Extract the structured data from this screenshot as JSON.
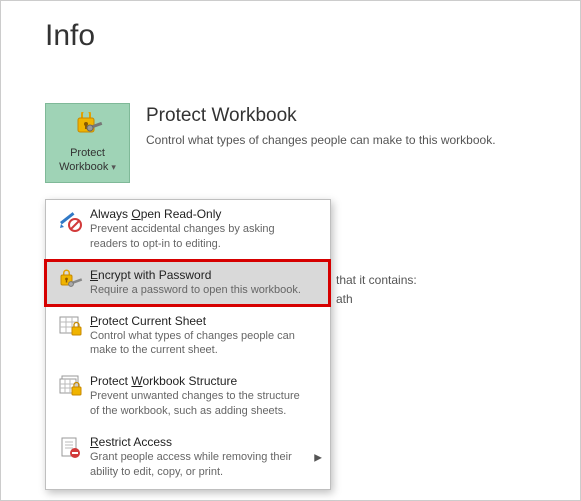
{
  "page": {
    "title": "Info"
  },
  "protectButton": {
    "line1": "Protect",
    "line2": "Workbook"
  },
  "section": {
    "heading": "Protect Workbook",
    "description": "Control what types of changes people can make to this workbook."
  },
  "behind": {
    "line1": "that it contains:",
    "line2": "ath"
  },
  "menu": {
    "items": [
      {
        "titlePre": "Always ",
        "titleUl": "O",
        "titlePost": "pen Read-Only",
        "desc": "Prevent accidental changes by asking readers to opt-in to editing."
      },
      {
        "titlePre": "",
        "titleUl": "E",
        "titlePost": "ncrypt with Password",
        "desc": "Require a password to open this workbook."
      },
      {
        "titlePre": "",
        "titleUl": "P",
        "titlePost": "rotect Current Sheet",
        "desc": "Control what types of changes people can make to the current sheet."
      },
      {
        "titlePre": "Protect ",
        "titleUl": "W",
        "titlePost": "orkbook Structure",
        "desc": "Prevent unwanted changes to the structure of the workbook, such as adding sheets."
      },
      {
        "titlePre": "",
        "titleUl": "R",
        "titlePost": "estrict Access",
        "desc": "Grant people access while removing their ability to edit, copy, or print."
      }
    ]
  }
}
